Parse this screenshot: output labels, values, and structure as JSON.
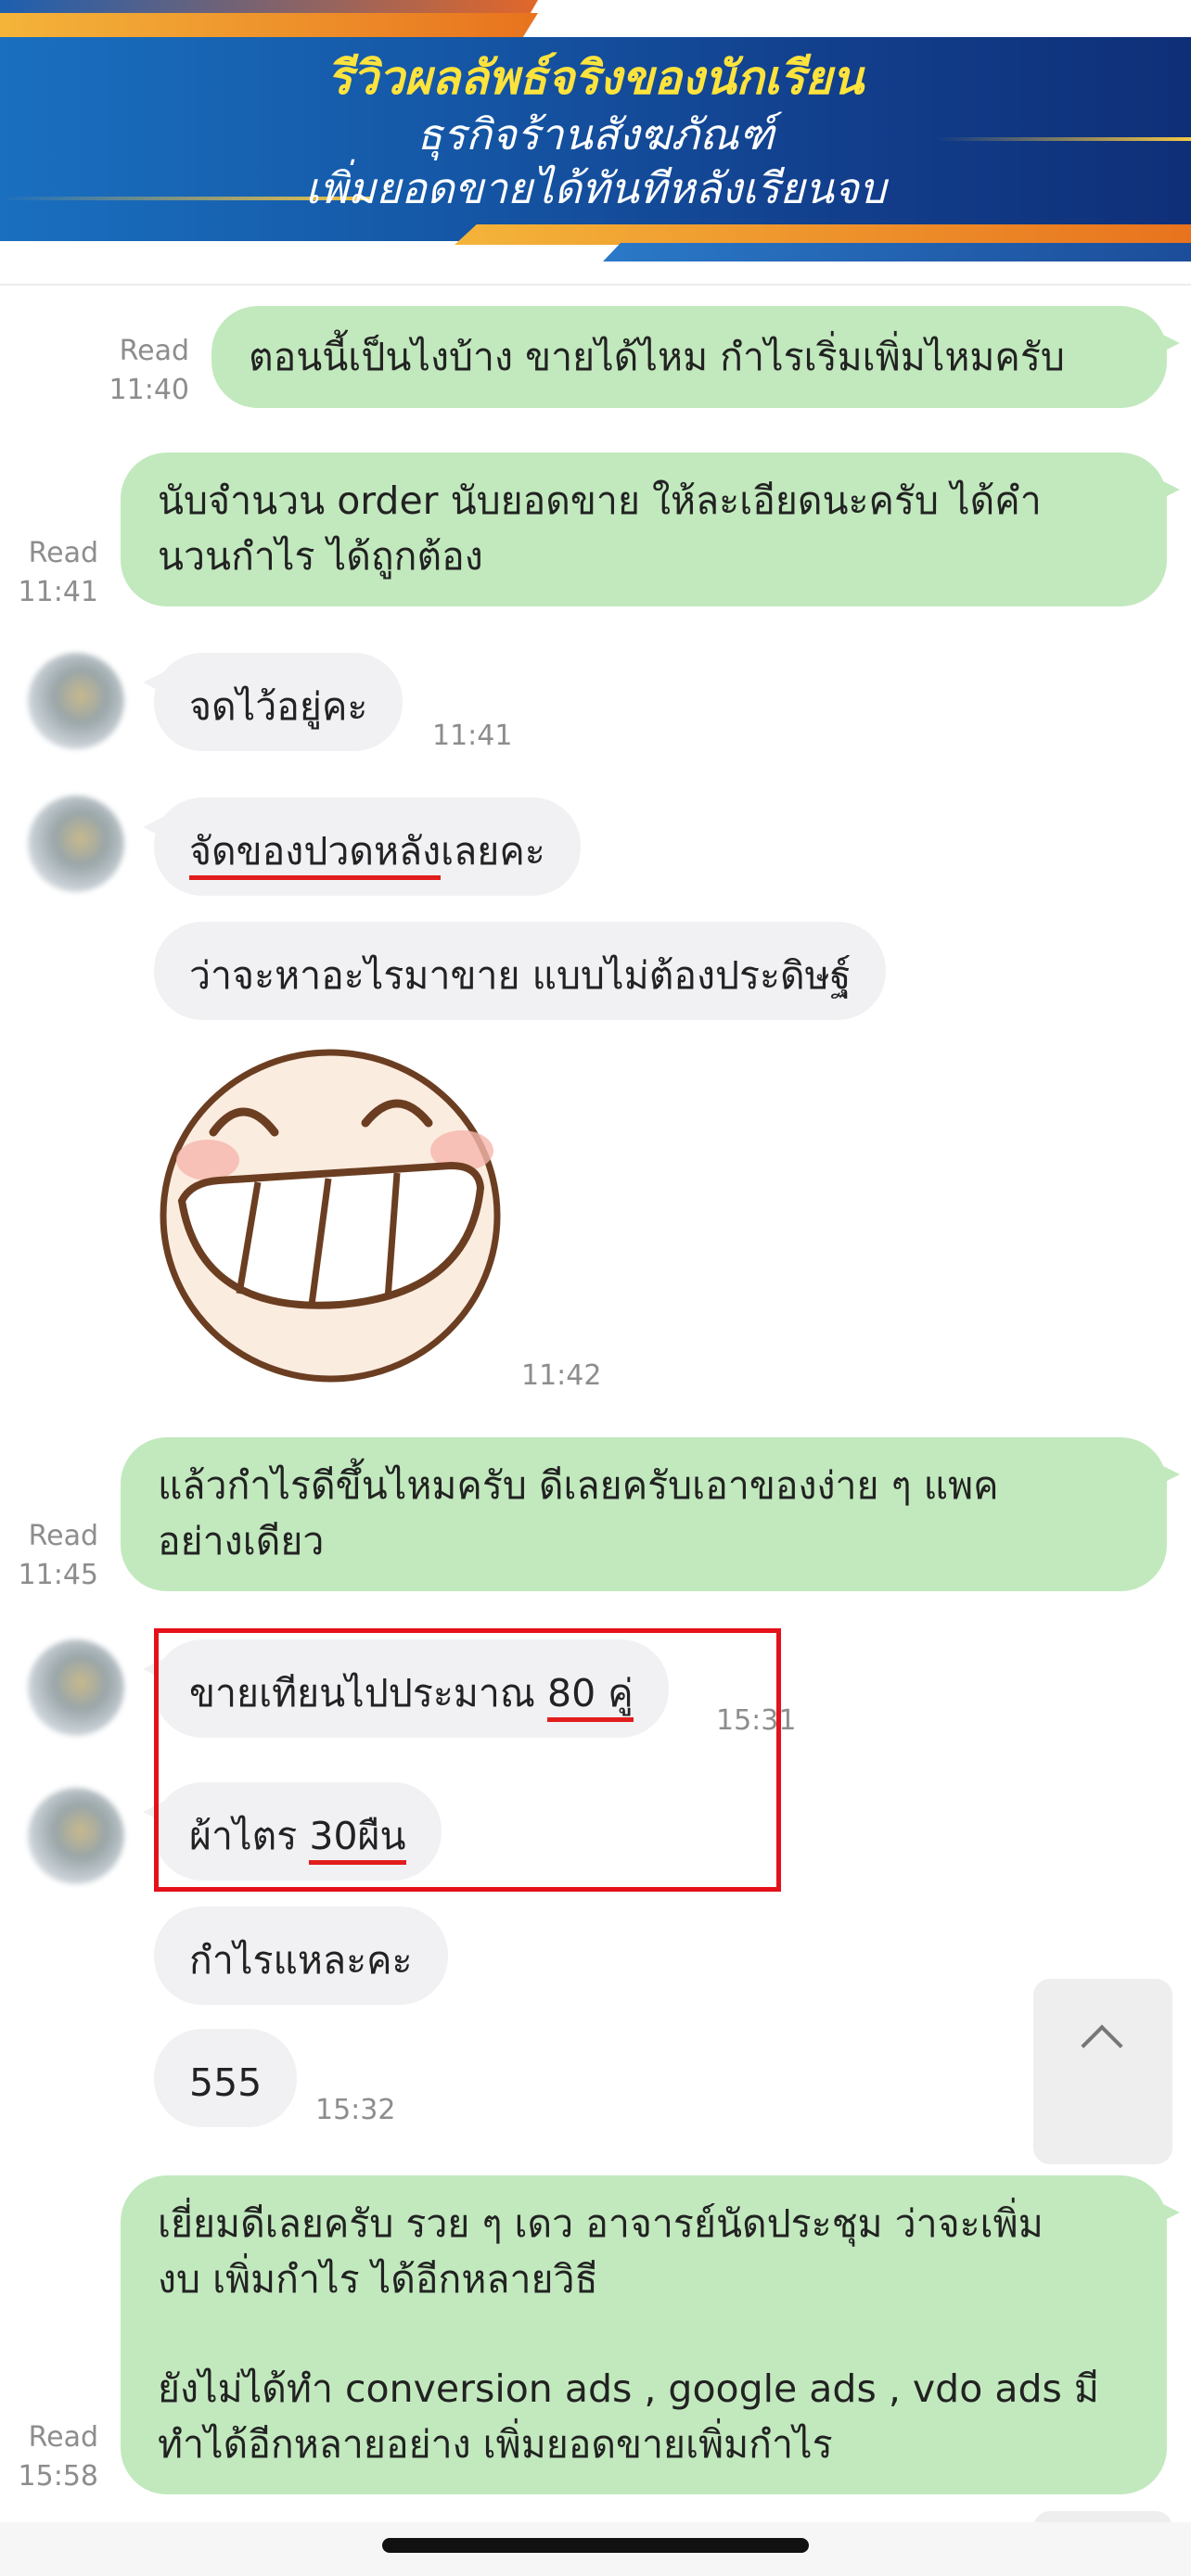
{
  "banner": {
    "title": "รีวิวผลลัพธ์จริงของนักเรียน",
    "line1": "ธุรกิจร้านสังฆภัณฑ์",
    "line2": "เพิ่มยอดขายได้ทันทีหลังเรียนจบ"
  },
  "messages": {
    "m1": {
      "read": "Read",
      "time": "11:40",
      "text": "ตอนนี้เป็นไงบ้าง ขายได้ไหม กำไรเริ่มเพิ่มไหมครับ"
    },
    "m2": {
      "read": "Read",
      "time": "11:41",
      "line1": "นับจำนวน order นับยอดขาย ให้ละเอียดนะครับ ได้คำ",
      "line2": "นวนกำไร ได้ถูกต้อง"
    },
    "m3": {
      "time": "11:41",
      "text": "จดไว้อยู่คะ"
    },
    "m4": {
      "text_underlined": "จัดของปวดหลัง",
      "text_rest": "เลยคะ"
    },
    "m5": {
      "text": "ว่าจะหาอะไรมาขาย แบบไม่ต้องประดิษฐ์"
    },
    "m6": {
      "sticker": "laughing-face-sticker",
      "time": "11:42"
    },
    "m7": {
      "read": "Read",
      "time": "11:45",
      "line1": "แล้วกำไรดีขึ้นไหมครับ ดีเลยครับเอาของง่าย ๆ แพค",
      "line2": "อย่างเดียว"
    },
    "m8": {
      "text_before": "ขายเทียนไปประมาณ ",
      "text_underlined": "80 คู่",
      "time": "15:31"
    },
    "m9": {
      "text_before": "ผ้าไตร ",
      "text_underlined": "30ผืน"
    },
    "m10": {
      "text": "กำไรแหละคะ"
    },
    "m11": {
      "text": "555",
      "time": "15:32"
    },
    "m12": {
      "read": "Read",
      "time": "15:58",
      "line1": "เยี่ยมดีเลยครับ รวย ๆ เดว อาจารย์นัดประชุม ว่าจะเพิ่ม",
      "line2": "งบ เพิ่มกำไร ได้อีกหลายวิธี",
      "line3": "ยังไม่ได้ทำ conversion ads , google ads , vdo ads มี",
      "line4": "ทำได้อีกหลายอย่าง เพิ่มยอดขายเพิ่มกำไร"
    }
  },
  "colors": {
    "outgoing_bubble": "#c2e9be",
    "incoming_bubble": "#f1f1f4",
    "highlight_red": "#e4101a",
    "banner_title": "#ffe33d",
    "banner_blue": "#1559a8"
  },
  "icons": {
    "scroll_button": "chevron-up-icon"
  }
}
